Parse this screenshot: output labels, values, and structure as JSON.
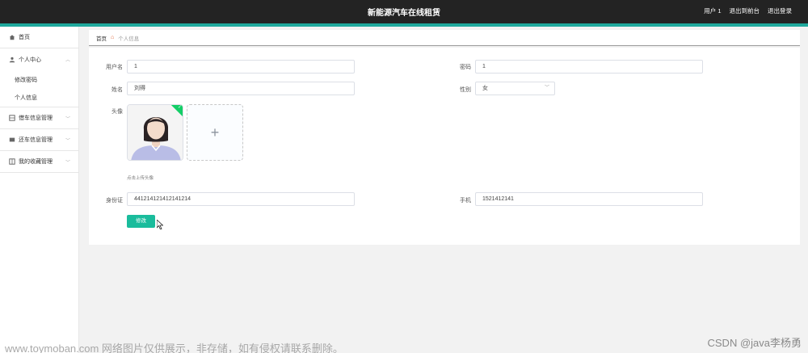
{
  "header": {
    "title": "新能源汽车在线租赁",
    "links": [
      "用户 1",
      "退出到前台",
      "退出登录"
    ],
    "colors": {
      "bar": "#232323",
      "accent": "#1ea89c"
    }
  },
  "sidebar": {
    "home": "首页",
    "personal_center": "个人中心",
    "personal_sub": [
      "修改密码",
      "个人信息"
    ],
    "groups": [
      "借车信息管理",
      "还车信息管理",
      "我的收藏管理"
    ]
  },
  "breadcrumb": {
    "home": "首页",
    "current": "个人信息"
  },
  "form": {
    "username_label": "用户名",
    "username_value": "1",
    "password_label": "密码",
    "password_value": "1",
    "name_label": "姓名",
    "name_value": "刘得",
    "gender_label": "性别",
    "gender_value": "女",
    "avatar_label": "头像",
    "upload_tip": "点击上传头像",
    "idcard_label": "身份证",
    "idcard_value": "441214121412141214",
    "phone_label": "手机",
    "phone_value": "1521412141",
    "submit_label": "修改"
  },
  "watermark": {
    "left": "www.toymoban.com 网络图片仅供展示，非存储，如有侵权请联系删除。",
    "right": "CSDN @java李杨勇"
  }
}
